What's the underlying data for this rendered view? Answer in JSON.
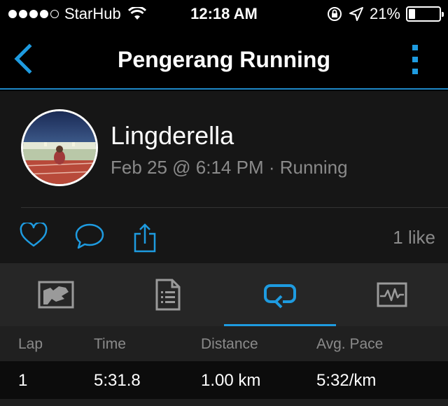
{
  "status": {
    "carrier": "StarHub",
    "time": "12:18 AM",
    "battery_pct": "21%",
    "battery_level": 0.21,
    "signal_bars_filled": 4
  },
  "nav": {
    "title": "Pengerang Running",
    "accent": "#1e9be0"
  },
  "activity": {
    "user_name": "Lingderella",
    "meta": "Feb 25 @ 6:14 PM · Running",
    "like_count": "1 like"
  },
  "tabs": [
    {
      "name": "map",
      "icon": "map-icon",
      "active": false
    },
    {
      "name": "details",
      "icon": "document-list-icon",
      "active": false
    },
    {
      "name": "laps",
      "icon": "laps-loop-icon",
      "active": true
    },
    {
      "name": "charts",
      "icon": "chart-pulse-icon",
      "active": false
    }
  ],
  "laps": {
    "headers": {
      "lap": "Lap",
      "time": "Time",
      "distance": "Distance",
      "pace": "Avg. Pace"
    },
    "rows": [
      {
        "lap": "1",
        "time": "5:31.8",
        "distance": "1.00 km",
        "pace": "5:32/km"
      }
    ]
  }
}
